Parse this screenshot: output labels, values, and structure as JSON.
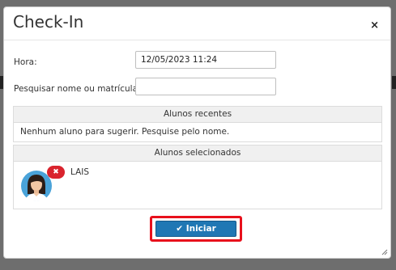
{
  "modal": {
    "title": "Check-In",
    "close_glyph": "×",
    "close_icon": "close-icon"
  },
  "form": {
    "hora_label": "Hora:",
    "hora_value": "12/05/2023 11:24",
    "search_label": "Pesquisar nome ou matrícula:",
    "search_value": ""
  },
  "recent": {
    "header": "Alunos recentes",
    "empty_message": "Nenhum aluno para sugerir. Pesquise pelo nome."
  },
  "selected": {
    "header": "Alunos selecionados",
    "students": [
      {
        "name": "LAIS",
        "remove_glyph": "✖",
        "avatar_icon": "female-avatar-icon"
      }
    ]
  },
  "actions": {
    "start_label": "Iniciar",
    "start_icon": "checkmark-icon",
    "start_glyph": "✔"
  },
  "colors": {
    "primary": "#1f77b4",
    "highlight": "#e8101c",
    "remove": "#d9232d"
  }
}
